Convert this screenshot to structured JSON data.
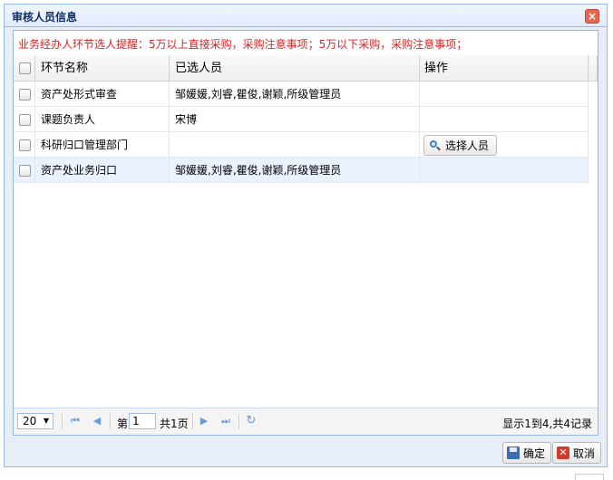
{
  "dialog": {
    "title": "审核人员信息",
    "close_glyph": "×",
    "notice": "业务经办人环节选人提醒：5万以上直接采购，采购注意事项；5万以下采购，采购注意事项；"
  },
  "grid": {
    "headers": {
      "name": "环节名称",
      "selected": "已选人员",
      "action": "操作"
    },
    "rows": [
      {
        "name": "资产处形式审查",
        "selected": "邹媛媛,刘睿,瞿俊,谢颖,所级管理员",
        "action": ""
      },
      {
        "name": "课题负责人",
        "selected": "宋博",
        "action": ""
      },
      {
        "name": "科研归口管理部门",
        "selected": "",
        "action": "选择人员"
      },
      {
        "name": "资产处业务归口",
        "selected": "邹媛媛,刘睿,瞿俊,谢颖,所级管理员",
        "action": ""
      }
    ]
  },
  "pager": {
    "page_size": "20",
    "page_prefix": "第",
    "page_value": "1",
    "page_suffix": "共1页",
    "info": "显示1到4,共4记录"
  },
  "footer": {
    "ok_label": "确定",
    "cancel_label": "取消"
  },
  "colors": {
    "notice": "#e02020",
    "border": "#95b8e7",
    "selected_row": "#eaf2ff"
  }
}
